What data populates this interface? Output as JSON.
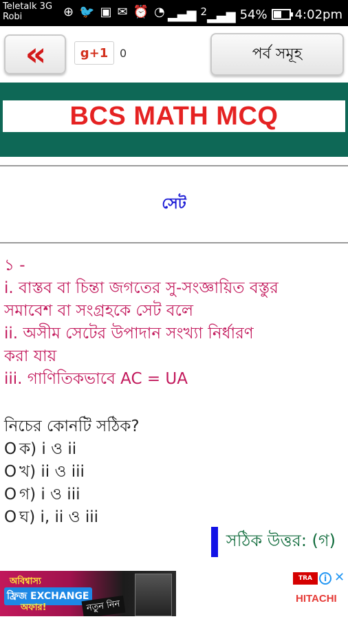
{
  "status_bar": {
    "carrier_line1": "Teletalk 3G",
    "carrier_line2": "Robi",
    "signal_2": "2",
    "battery": "54%",
    "time": "4:02pm"
  },
  "toolbar": {
    "back_label": "«",
    "gplus_label": "g+1",
    "gplus_count": "0",
    "chapters_label": "পর্ব সমূহ"
  },
  "banner": {
    "title": "BCS MATH MCQ"
  },
  "section": {
    "title": "সেট"
  },
  "question": {
    "number": "১ -",
    "statements": [
      "i. বাস্তব বা চিন্তা জগতের সু-সংজ্ঞায়িত বস্তুর",
      "সমাবেশ বা সংগ্রহকে সেট বলে",
      "ii. অসীম সেটের উপাদান সংখ্যা নির্ধারণ",
      "করা যায়",
      "iii. গাণিতিকভাবে AC = UA"
    ],
    "prompt": "নিচের কোনটি সঠিক?",
    "options": [
      {
        "marker": "O",
        "label": "ক) i ও ii"
      },
      {
        "marker": "O",
        "label": "খ) ii ও iii"
      },
      {
        "marker": "O",
        "label": "গ) i ও iii"
      },
      {
        "marker": "O",
        "label": "ঘ) i, ii ও iii"
      }
    ],
    "answer": "সঠিক উত্তর: (গ)"
  },
  "ad": {
    "line1": "অবিশ্বাস্য",
    "line2": "ফ্রিজ EXCHANGE",
    "line3": "অফার!",
    "badge": "নতুন নিন",
    "logo_text": "TRA",
    "info": "i",
    "close": "✕",
    "brand": "HITACHI"
  }
}
